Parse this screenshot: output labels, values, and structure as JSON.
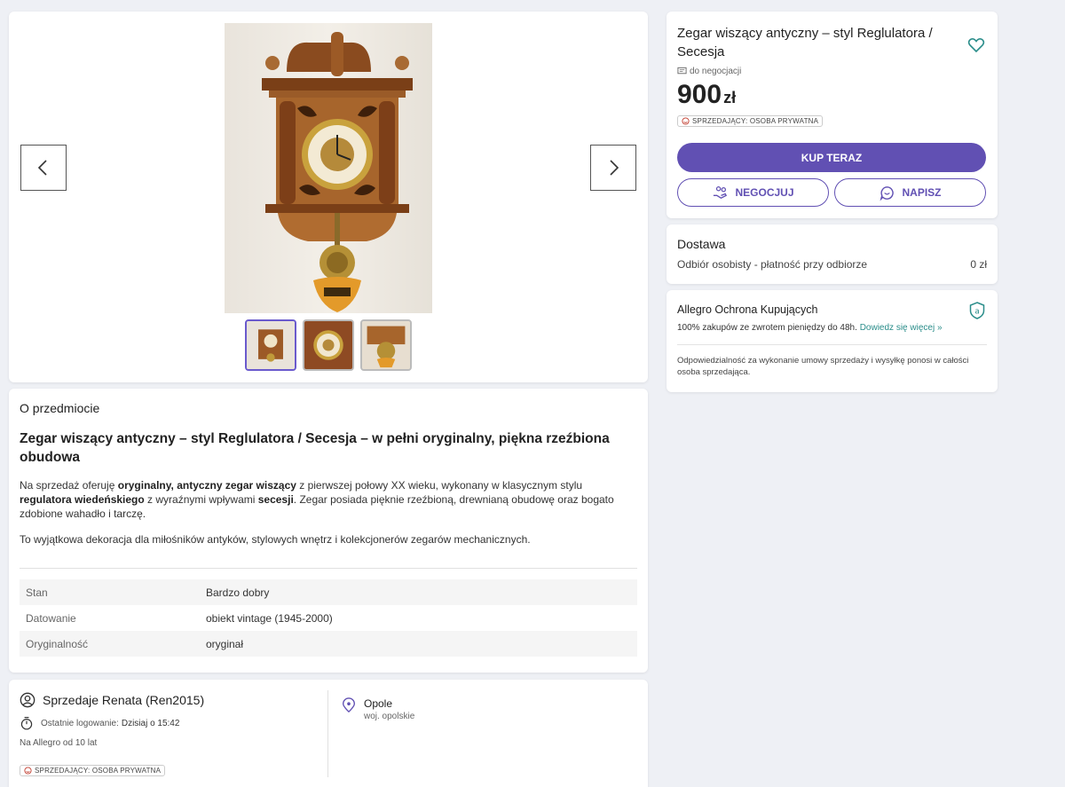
{
  "gallery": {
    "prev_icon": "chevron-left-icon",
    "next_icon": "chevron-right-icon",
    "thumbnails": [
      "thumbnail-1",
      "thumbnail-2",
      "thumbnail-3"
    ]
  },
  "about": {
    "section_title": "O przedmiocie",
    "headline": "Zegar wiszący antyczny – styl Reglulatora / Secesja – w pełni oryginalny, piękna rzeźbiona obudowa",
    "p1": {
      "t1": "Na sprzedaż oferuję ",
      "b1": "oryginalny, antyczny zegar wiszący",
      "t2": " z pierwszej połowy XX wieku, wykonany w klasycznym stylu ",
      "b2": "regulatora wiedeńskiego",
      "t3": " z wyraźnymi wpływami ",
      "b3": "secesji",
      "t4": ". Zegar posiada pięknie rzeźbioną, drewnianą obudowę oraz bogato zdobione wahadło i tarczę."
    },
    "p2": "To wyjątkowa dekoracja dla miłośników antyków, stylowych wnętrz i kolekcjonerów zegarów mechanicznych.",
    "params": [
      {
        "label": "Stan",
        "value": "Bardzo dobry"
      },
      {
        "label": "Datowanie",
        "value": "obiekt vintage (1945-2000)"
      },
      {
        "label": "Oryginalność",
        "value": "oryginał"
      }
    ]
  },
  "seller": {
    "name": "Sprzedaje Renata (Ren2015)",
    "last_login_label": "Ostatnie logowanie:",
    "last_login_value": "Dzisiaj o 15:42",
    "since": "Na Allegro od 10 lat",
    "badge": "SPRZEDAJĄCY: OSOBA PRYWATNA",
    "city": "Opole",
    "region": "woj. opolskie"
  },
  "offer": {
    "title": "Zegar wiszący antyczny – styl Reglulatora / Secesja",
    "negotiable": "do negocjacji",
    "price": "900",
    "currency": "zł",
    "badge": "SPRZEDAJĄCY: OSOBA PRYWATNA",
    "buy_label": "KUP TERAZ",
    "negotiate_label": "NEGOCJUJ",
    "message_label": "NAPISZ"
  },
  "delivery": {
    "title": "Dostawa",
    "method": "Odbiór osobisty - płatność przy odbiorze",
    "cost": "0 zł"
  },
  "protection": {
    "title": "Allegro Ochrona Kupujących",
    "text": "100% zakupów ze zwrotem pieniędzy do 48h.",
    "link": "Dowiedz się więcej »",
    "note": "Odpowiedzialność za wykonanie umowy sprzedaży i wysyłkę ponosi w całości osoba sprzedająca."
  },
  "colors": {
    "accent": "#6150b3",
    "teal": "#2a8d8a",
    "background": "#eef0f5"
  }
}
